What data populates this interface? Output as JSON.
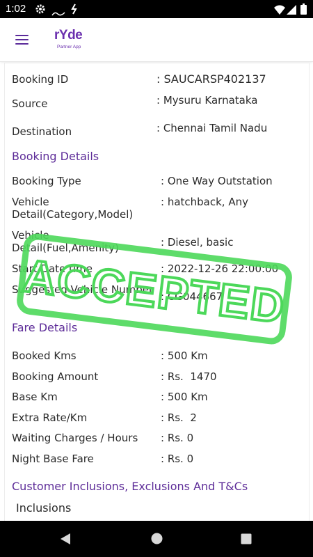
{
  "status_bar": {
    "time": "1:02"
  },
  "app": {
    "logo_text": "rYde",
    "logo_subtitle": "Partner App"
  },
  "booking": {
    "id_label": "Booking ID",
    "id_value": ": SAUCARSP402137",
    "source_label": "Source",
    "source_value": ": Mysuru Karnataka",
    "destination_label": "Destination",
    "destination_value": ": Chennai Tamil Nadu"
  },
  "booking_details": {
    "heading": "Booking Details",
    "rows": [
      {
        "label": "Booking Type",
        "value": ": One Way Outstation"
      },
      {
        "label": "Vehicle Detail(Category,Model)",
        "value": ": hatchback, Any"
      },
      {
        "label": "Vehicle Detail(Fuel,Amenity)",
        "value": ": Diesel, basic"
      },
      {
        "label": "Start Date time",
        "value": ": 2022-12-26 22:00:00"
      },
      {
        "label": "Suggested Vehicle Number",
        "value": ": CG044667"
      }
    ]
  },
  "fare_details": {
    "heading": "Fare Details",
    "rows": [
      {
        "label": "Booked Kms",
        "value": ": 500 Km"
      },
      {
        "label": "Booking Amount",
        "value": ": Rs.  1470"
      },
      {
        "label": "Base Km",
        "value": ": 500 Km"
      },
      {
        "label": "Extra Rate/Km",
        "value": ": Rs.  2"
      },
      {
        "label": "Waiting Charges / Hours",
        "value": ": Rs. 0"
      },
      {
        "label": "Night Base Fare",
        "value": ": Rs. 0"
      }
    ]
  },
  "customer": {
    "heading": "Customer Inclusions, Exclusions And T&Cs",
    "inclusions_label": "Inclusions"
  },
  "stamp": {
    "text": "ACCEPTED",
    "color": "#4cd85a"
  },
  "colors": {
    "accent": "#5d2c98"
  }
}
